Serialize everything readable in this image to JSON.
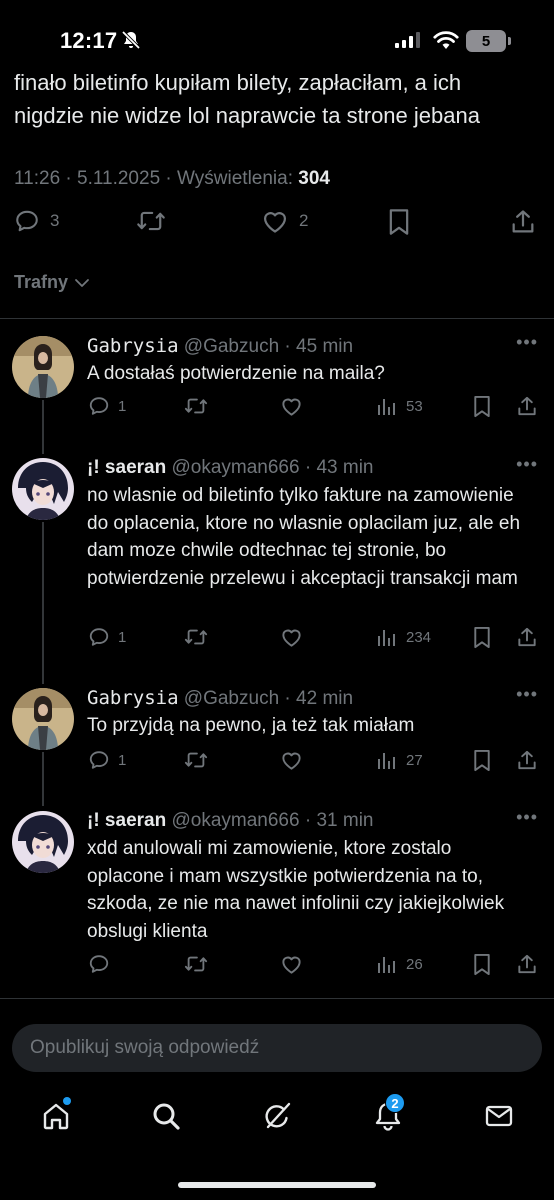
{
  "status_bar": {
    "time": "12:17",
    "battery": "5"
  },
  "post": {
    "text_lines": [
      "finało biletinfo kupiłam bilety, zapłaciłam, a ich",
      "nigdzie nie widze lol naprawcie ta strone jebana"
    ],
    "timestamp": "11:26 · 5.11.2025 · Wyświetlenia: ",
    "views": "304",
    "replies": "3",
    "likes": "2"
  },
  "sort_label": "Trafny",
  "replies": [
    {
      "name": "Gabrysia",
      "handle": "@Gabzuch",
      "time": " · 45 min",
      "text": "A dostałaś potwierdzenie na maila?",
      "reply_count": "1",
      "views": "53"
    },
    {
      "name": "¡! saeran",
      "handle": "@okayman666",
      "time": " · 43 min",
      "text": "no wlasnie od biletinfo tylko fakture na zamowienie do oplacenia, ktore no wlasnie oplacilam juz, ale eh dam moze chwile odtechnac tej stronie, bo potwierdzenie przelewu i akceptacji transakcji mam",
      "reply_count": "1",
      "views": "234"
    },
    {
      "name": "Gabrysia",
      "handle": "@Gabzuch",
      "time": " · 42 min",
      "text": "To przyjdą na pewno, ja też tak miałam",
      "reply_count": "1",
      "views": "27"
    },
    {
      "name": "¡! saeran",
      "handle": "@okayman666",
      "time": " · 31 min",
      "text": "xdd anulowali mi zamowienie, ktore zostalo oplacone i mam wszystkie potwierdzenia na to, szkoda, ze nie ma nawet infolinii czy jakiejkolwiek obslugi klienta",
      "reply_count": "",
      "views": "26"
    }
  ],
  "composer": {
    "placeholder": "Opublikuj swoją odpowiedź"
  },
  "tabbar": {
    "notifications_badge": "2"
  },
  "colors": {
    "accent": "#1d9bf0",
    "muted": "#71767b",
    "text": "#e7e9ea",
    "background": "#000000"
  }
}
